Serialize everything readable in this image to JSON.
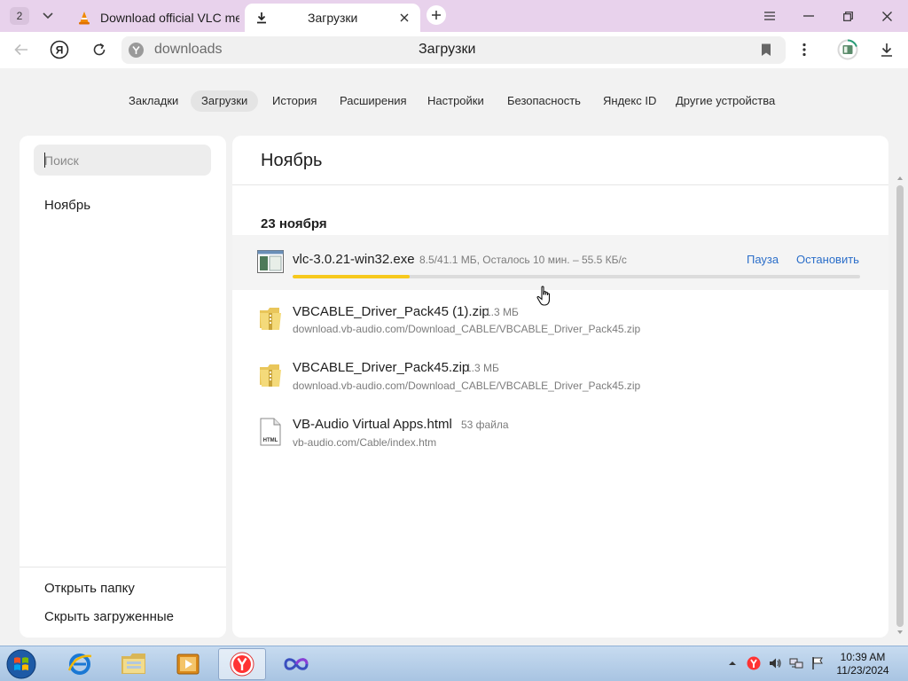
{
  "tabs": {
    "count": "2",
    "inactive_title": "Download official VLC media player",
    "active_title": "Загрузки"
  },
  "address": {
    "url": "downloads",
    "page_title": "Загрузки"
  },
  "nav": [
    {
      "label": "Закладки"
    },
    {
      "label": "Загрузки"
    },
    {
      "label": "История"
    },
    {
      "label": "Расширения"
    },
    {
      "label": "Настройки"
    },
    {
      "label": "Безопасность"
    },
    {
      "label": "Яндекс ID"
    },
    {
      "label": "Другие устройства"
    }
  ],
  "sidebar": {
    "search_placeholder": "Поиск",
    "month": "Ноябрь",
    "open_folder": "Открыть папку",
    "hide_downloaded": "Скрыть загруженные"
  },
  "main": {
    "month_title": "Ноябрь",
    "date_heading": "23 ноября",
    "active_download": {
      "name": "vlc-3.0.21-win32.exe",
      "status": "8.5/41.1 МБ, Осталось 10 мин. – 55.5 КБ/с",
      "pause_label": "Пауза",
      "stop_label": "Остановить",
      "progress_percent": 20.7
    },
    "downloads": [
      {
        "name": "VBCABLE_Driver_Pack45 (1).zip",
        "size": "1.3 МБ",
        "url": "download.vb-audio.com/Download_CABLE/VBCABLE_Driver_Pack45.zip",
        "icon": "zip-folder-icon"
      },
      {
        "name": "VBCABLE_Driver_Pack45.zip",
        "size": "1.3 МБ",
        "url": "download.vb-audio.com/Download_CABLE/VBCABLE_Driver_Pack45.zip",
        "icon": "zip-folder-icon"
      },
      {
        "name": "VB-Audio Virtual Apps.html",
        "size": "53 файла",
        "url": "vb-audio.com/Cable/index.htm",
        "icon": "html-file-icon"
      }
    ]
  },
  "taskbar": {
    "time": "10:39 AM",
    "date": "11/23/2024"
  },
  "colors": {
    "tabstrip": "#e8d2ec",
    "progress": "#f7c91d",
    "link": "#2b6ec9"
  }
}
